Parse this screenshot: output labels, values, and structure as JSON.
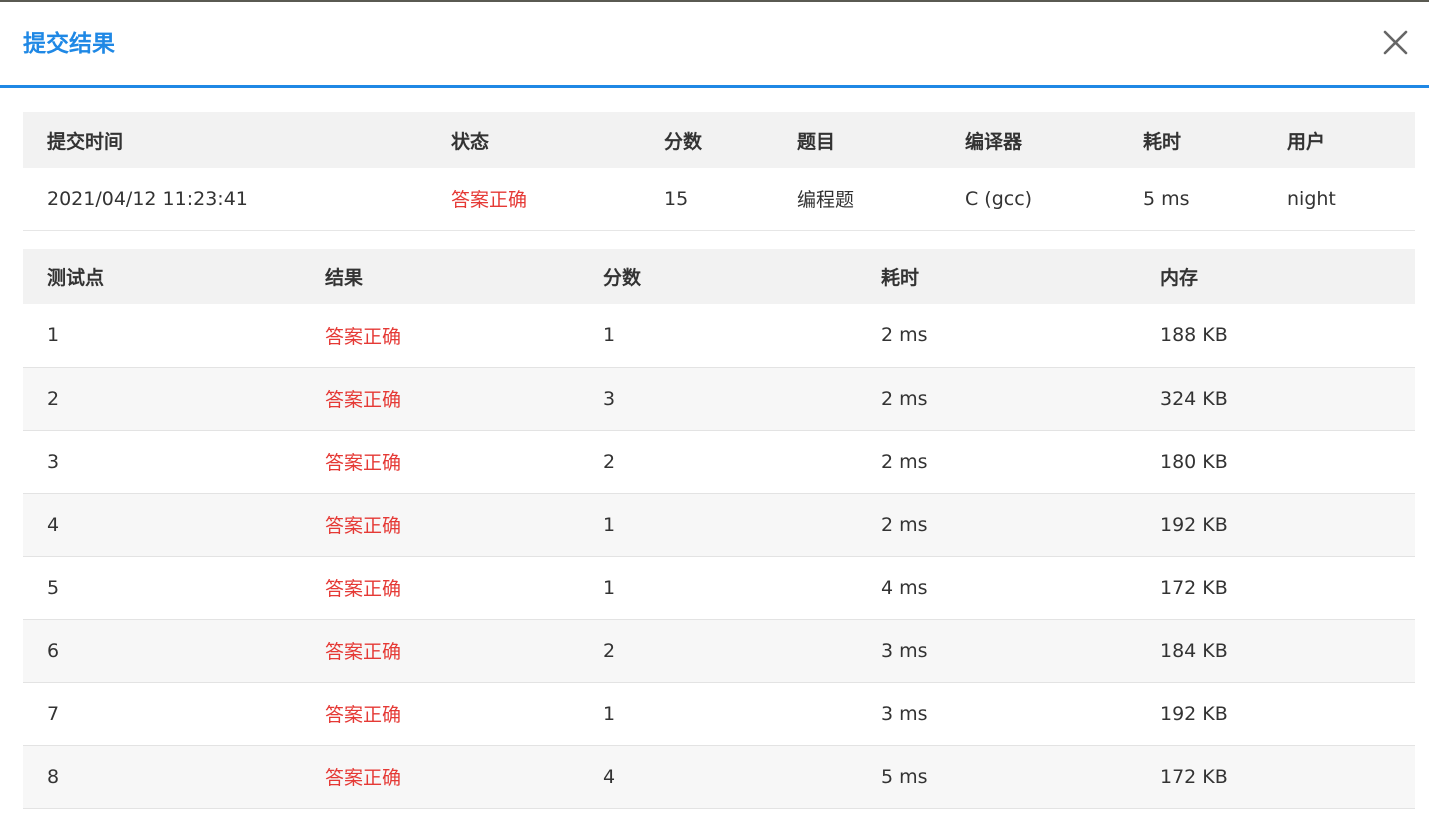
{
  "dialog": {
    "title": "提交结果",
    "close_icon": "close-icon"
  },
  "colors": {
    "accent": "#1f88e5",
    "success_text": "#e53935",
    "header_bg": "#f2f2f2",
    "alt_row_bg": "#f7f7f7"
  },
  "summary": {
    "headers": {
      "time": "提交时间",
      "status": "状态",
      "score": "分数",
      "problem": "题目",
      "compiler": "编译器",
      "duration": "耗时",
      "user": "用户"
    },
    "row": {
      "time": "2021/04/12 11:23:41",
      "status": "答案正确",
      "score": "15",
      "problem": "编程题",
      "compiler": "C (gcc)",
      "duration": "5 ms",
      "user": "night"
    }
  },
  "cases": {
    "headers": {
      "case": "测试点",
      "result": "结果",
      "score": "分数",
      "duration": "耗时",
      "memory": "内存"
    },
    "rows": [
      {
        "case": "1",
        "result": "答案正确",
        "score": "1",
        "duration": "2 ms",
        "memory": "188 KB"
      },
      {
        "case": "2",
        "result": "答案正确",
        "score": "3",
        "duration": "2 ms",
        "memory": "324 KB"
      },
      {
        "case": "3",
        "result": "答案正确",
        "score": "2",
        "duration": "2 ms",
        "memory": "180 KB"
      },
      {
        "case": "4",
        "result": "答案正确",
        "score": "1",
        "duration": "2 ms",
        "memory": "192 KB"
      },
      {
        "case": "5",
        "result": "答案正确",
        "score": "1",
        "duration": "4 ms",
        "memory": "172 KB"
      },
      {
        "case": "6",
        "result": "答案正确",
        "score": "2",
        "duration": "3 ms",
        "memory": "184 KB"
      },
      {
        "case": "7",
        "result": "答案正确",
        "score": "1",
        "duration": "3 ms",
        "memory": "192 KB"
      },
      {
        "case": "8",
        "result": "答案正确",
        "score": "4",
        "duration": "5 ms",
        "memory": "172 KB"
      }
    ]
  }
}
